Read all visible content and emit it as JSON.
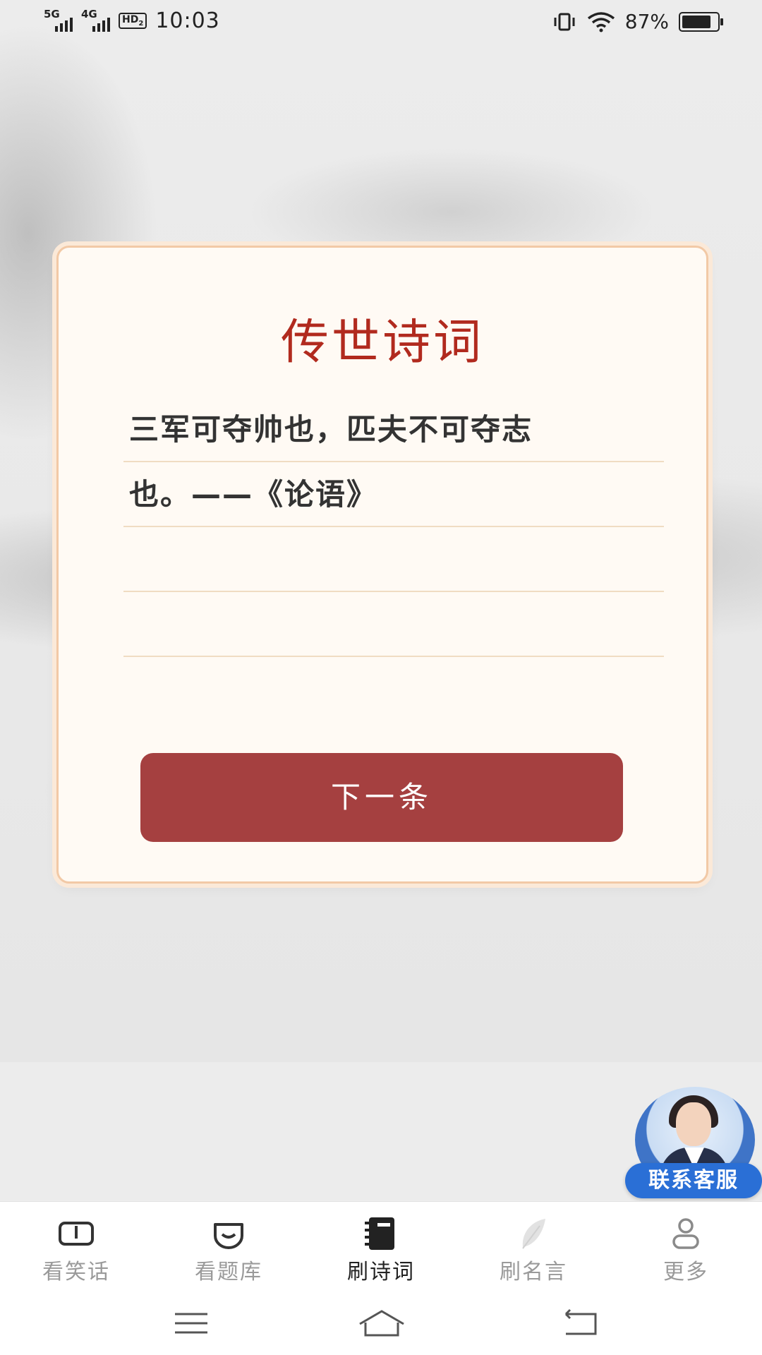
{
  "status_bar": {
    "signal1_label": "5G",
    "signal2_label": "4G",
    "hd_label": "HD",
    "hd_sub": "2",
    "time": "10:03",
    "battery_percent": "87%",
    "battery_level": 0.87
  },
  "card": {
    "title": "传世诗词",
    "lines": [
      "三军可夺帅也，匹夫不可夺志",
      "也。——《论语》",
      "",
      ""
    ],
    "next_label": "下一条"
  },
  "customer_service": {
    "label": "联系客服"
  },
  "bottom_nav": {
    "items": [
      {
        "label": "看笑话",
        "icon": "book-open-icon",
        "active": false
      },
      {
        "label": "看题库",
        "icon": "smile-icon",
        "active": false
      },
      {
        "label": "刷诗词",
        "icon": "notebook-icon",
        "active": true
      },
      {
        "label": "刷名言",
        "icon": "feather-icon",
        "active": false
      },
      {
        "label": "更多",
        "icon": "user-icon",
        "active": false
      }
    ]
  },
  "colors": {
    "accent_red": "#a54040",
    "title_red": "#b12a1e",
    "card_bg": "#fffaf4",
    "service_blue": "#2a6fd6"
  }
}
